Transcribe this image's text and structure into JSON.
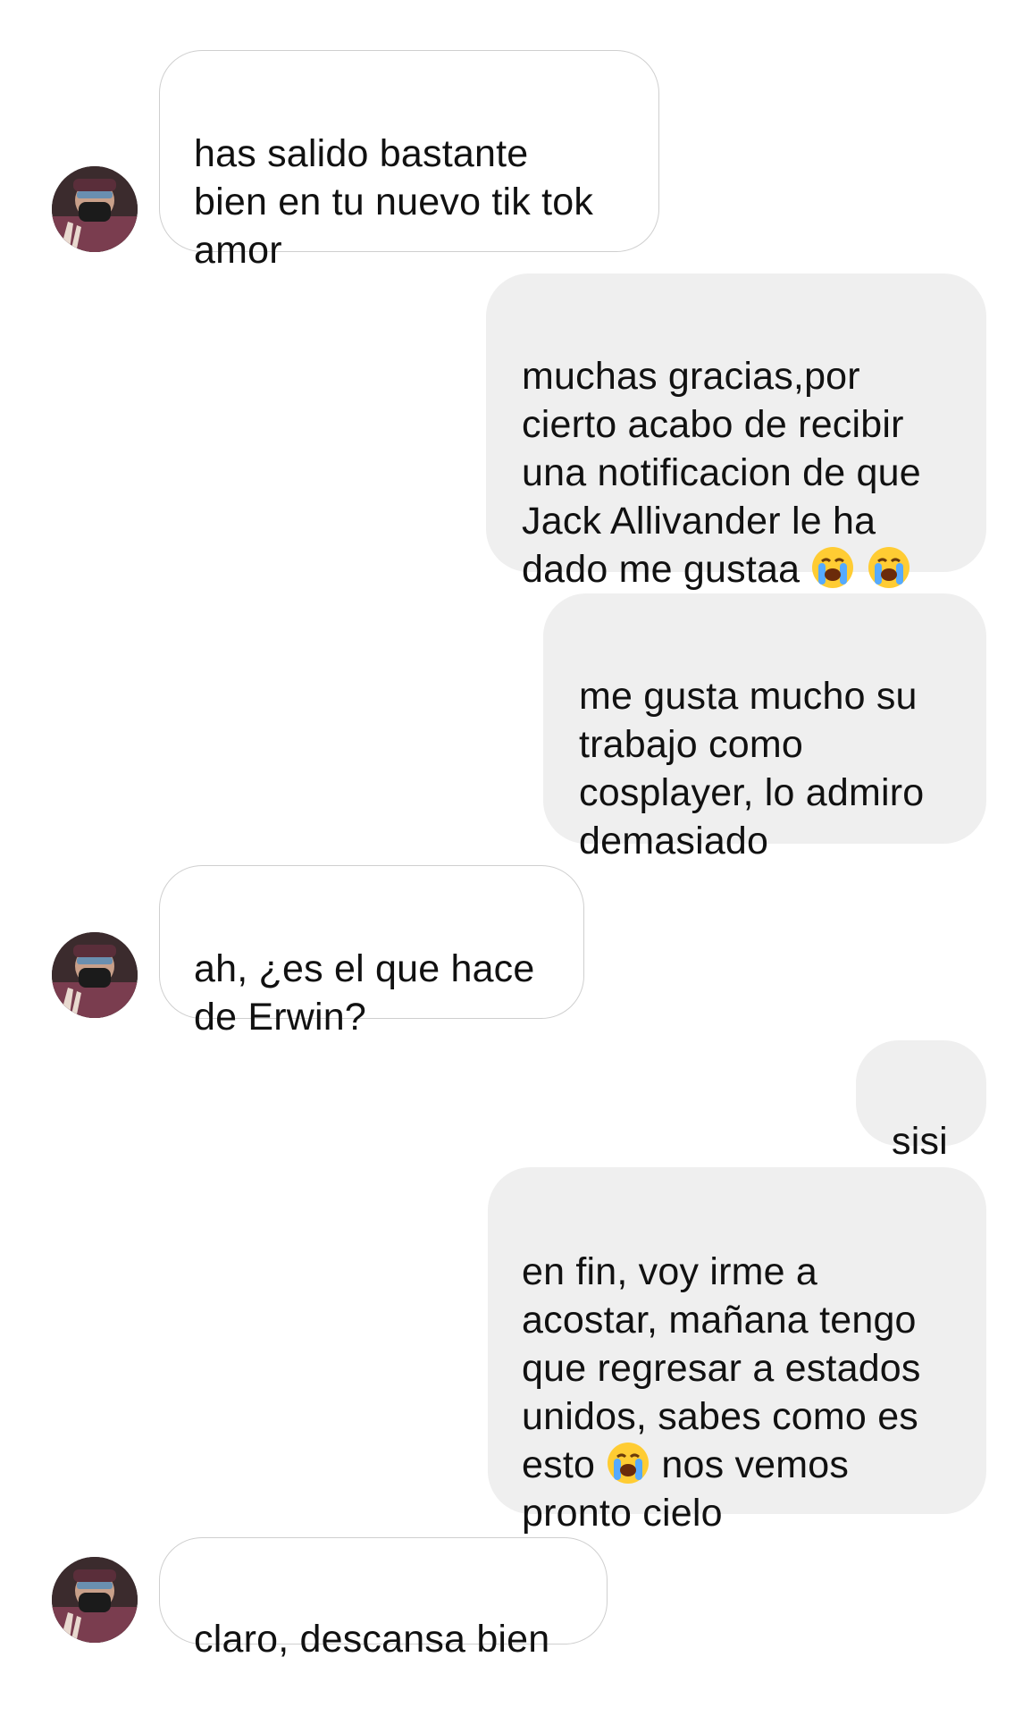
{
  "conversation": {
    "messages": [
      {
        "direction": "incoming",
        "text": "has salido bastante\nbien en tu nuevo tik tok\namor"
      },
      {
        "direction": "outgoing",
        "text_before_emoji": "muchas gracias,por\ncierto acabo de recibir\nuna notificacion de que\nJack Allivander le ha\ndado me gustaa ",
        "emoji": [
          "loudly-crying-face-emoji",
          "loudly-crying-face-emoji"
        ]
      },
      {
        "direction": "outgoing",
        "text": "me gusta mucho su\ntrabajo como\ncosplayer, lo admiro\ndemasiado"
      },
      {
        "direction": "incoming",
        "text": "ah, ¿es el que hace\nde Erwin?"
      },
      {
        "direction": "outgoing",
        "text": "sisi"
      },
      {
        "direction": "outgoing",
        "text_before_emoji": "en fin, voy irme a\nacostar, mañana tengo\nque regresar a estados\nunidos, sabes como es\nesto ",
        "emoji": [
          "loudly-crying-face-emoji"
        ],
        "text_after_emoji": " nos vemos\npronto cielo"
      },
      {
        "direction": "incoming",
        "text": "claro, descansa bien"
      }
    ]
  },
  "colors": {
    "incoming_bubble_bg": "#ffffff",
    "incoming_bubble_border": "#cfcfcf",
    "outgoing_bubble_bg": "#efefef",
    "text": "#111111"
  },
  "icons": {
    "avatar": "contact-avatar-icon",
    "emoji": "loudly-crying-face-emoji"
  }
}
